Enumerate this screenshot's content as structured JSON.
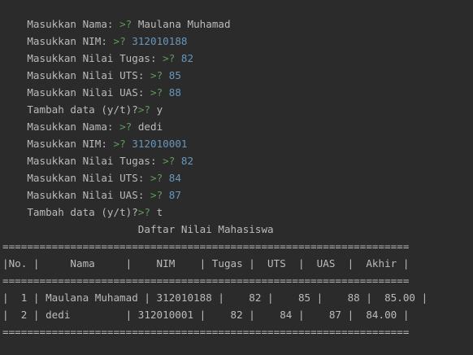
{
  "colors": {
    "background": "#2b2b2b",
    "text": "#bbbbbb",
    "prompt": "#5e9c5a",
    "number_input": "#6897bb"
  },
  "console": {
    "prompt_symbol": ">?",
    "entries": [
      {
        "label": "Masukkan Nama: ",
        "value": "Maulana Muhamad",
        "numeric": false
      },
      {
        "label": "Masukkan NIM: ",
        "value": "312010188",
        "numeric": true
      },
      {
        "label": "Masukkan Nilai Tugas: ",
        "value": "82",
        "numeric": true
      },
      {
        "label": "Masukkan Nilai UTS: ",
        "value": "85",
        "numeric": true
      },
      {
        "label": "Masukkan Nilai UAS: ",
        "value": "88",
        "numeric": true
      },
      {
        "label": "Tambah data (y/t)?",
        "value": "y",
        "numeric": false
      },
      {
        "label": "Masukkan Nama: ",
        "value": "dedi",
        "numeric": false
      },
      {
        "label": "Masukkan NIM: ",
        "value": "312010001",
        "numeric": true
      },
      {
        "label": "Masukkan Nilai Tugas: ",
        "value": "82",
        "numeric": true
      },
      {
        "label": "Masukkan Nilai UTS: ",
        "value": "84",
        "numeric": true
      },
      {
        "label": "Masukkan Nilai UAS: ",
        "value": "87",
        "numeric": true
      },
      {
        "label": "Tambah data (y/t)?",
        "value": "t",
        "numeric": false
      }
    ],
    "table_title": "                      Daftar Nilai Mahasiswa",
    "separator_line": "==================================================================",
    "header_line": "|No. |     Nama     |    NIM    | Tugas |  UTS  |  UAS  |  Akhir |",
    "data_rows": [
      "|  1 | Maulana Muhamad | 312010188 |    82 |    85 |    88 |  85.00 |",
      "|  2 | dedi         | 312010001 |    82 |    84 |    87 |  84.00 |"
    ]
  }
}
